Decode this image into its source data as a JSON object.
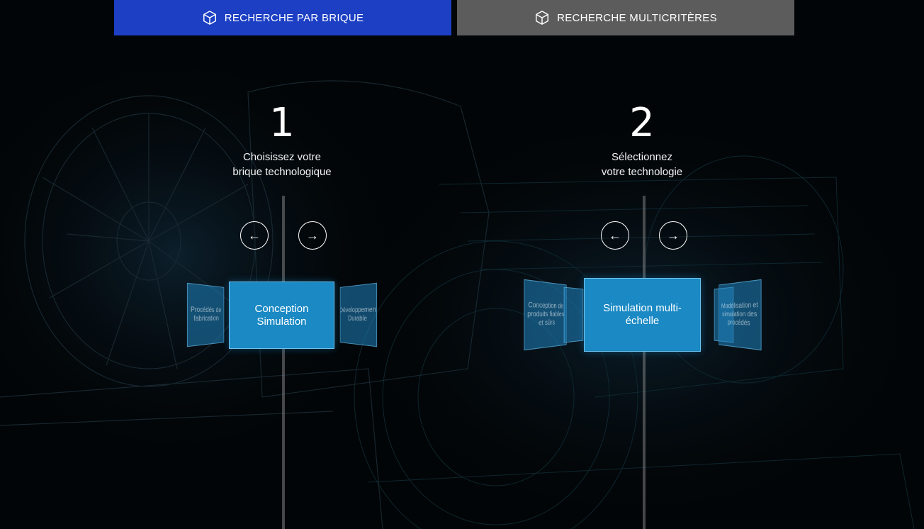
{
  "tabs": [
    {
      "label": "RECHERCHE PAR BRIQUE",
      "active": true,
      "icon": "cube-icon"
    },
    {
      "label": "RECHERCHE MULTICRITÈRES",
      "active": false,
      "icon": "cube-icon"
    }
  ],
  "colors": {
    "active_tab": "#1c3fc4",
    "inactive_tab": "#5c5c5c",
    "card": "#1a89c4",
    "background": "#020507"
  },
  "step1": {
    "number": "1",
    "line1": "Choisissez votre",
    "line2": "brique technologique",
    "prev_icon": "←",
    "next_icon": "→",
    "carousel": {
      "selected": "Conception Simulation",
      "left": "Procédés de fabrication",
      "right": "Développement Durable"
    }
  },
  "step2": {
    "number": "2",
    "line1": "Sélectionnez",
    "line2": "votre technologie",
    "prev_icon": "←",
    "next_icon": "→",
    "carousel": {
      "selected": "Simulation multi-échelle",
      "left_far": "Conception de produits fiables et sûrs",
      "right_far": "Modélisation et simulation des procédés"
    }
  }
}
